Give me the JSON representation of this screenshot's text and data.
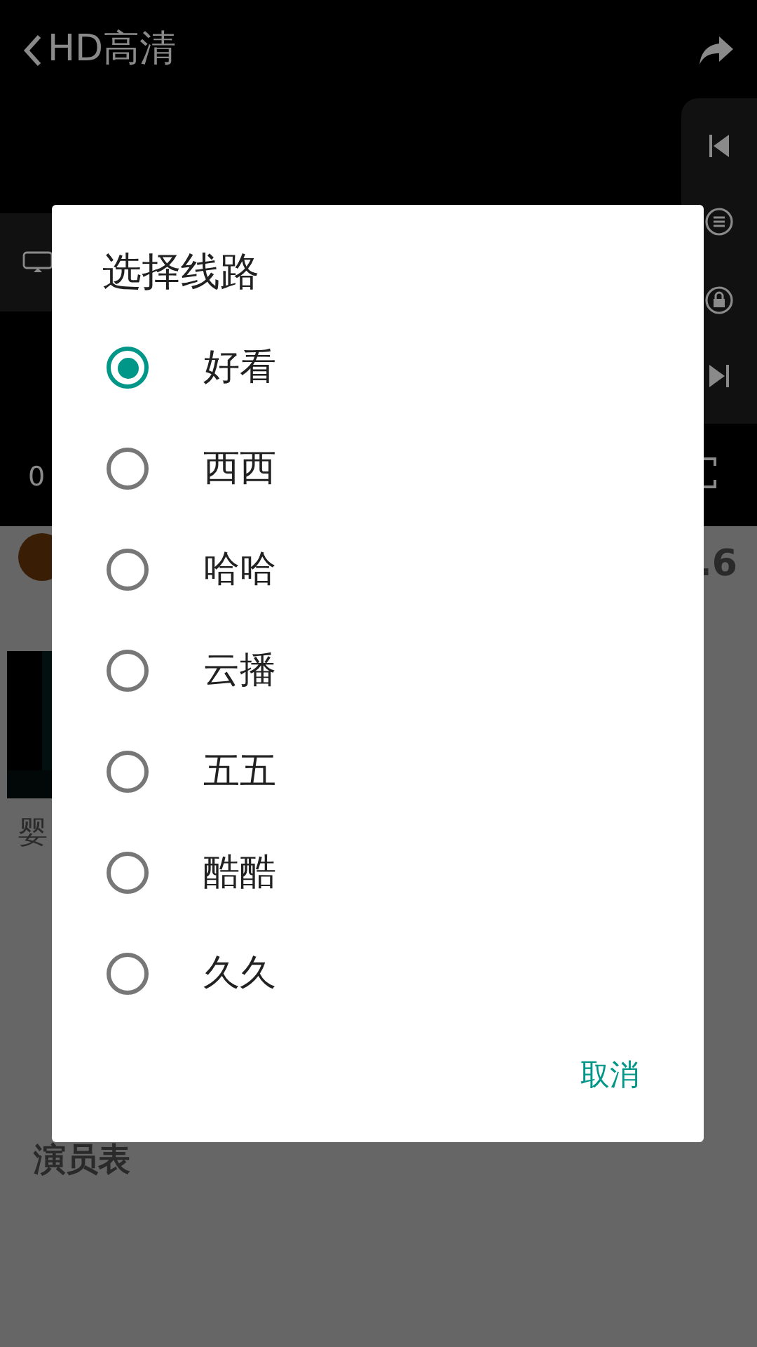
{
  "player": {
    "title": "HD高清",
    "time": "0"
  },
  "page": {
    "rating": ".6",
    "video_caption": "婴",
    "section_title": "演员表"
  },
  "dialog": {
    "title": "选择线路",
    "options": [
      {
        "label": "好看",
        "selected": true
      },
      {
        "label": "西西",
        "selected": false
      },
      {
        "label": "哈哈",
        "selected": false
      },
      {
        "label": "云播",
        "selected": false
      },
      {
        "label": "五五",
        "selected": false
      },
      {
        "label": "酷酷",
        "selected": false
      },
      {
        "label": "久久",
        "selected": false
      }
    ],
    "cancel": "取消"
  }
}
